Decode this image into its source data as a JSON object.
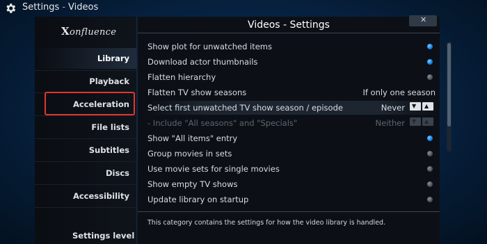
{
  "header": {
    "title": "Settings",
    "separator": "-",
    "subtitle": "Videos",
    "icon": "gear-icon"
  },
  "logo": {
    "first": "X",
    "rest": "onfluence"
  },
  "menu": {
    "items": [
      {
        "label": "Library"
      },
      {
        "label": "Playback"
      },
      {
        "label": "Acceleration"
      },
      {
        "label": "File lists"
      },
      {
        "label": "Subtitles"
      },
      {
        "label": "Discs"
      },
      {
        "label": "Accessibility"
      }
    ],
    "settings_level": "Settings level",
    "active_item": "Library",
    "highlighted_item": "Acceleration"
  },
  "panel": {
    "title": "Videos - Settings",
    "close_glyph": "✕",
    "rows": [
      {
        "label": "Show plot for unwatched items",
        "type": "toggle",
        "on": true
      },
      {
        "label": "Download actor thumbnails",
        "type": "toggle",
        "on": true
      },
      {
        "label": "Flatten hierarchy",
        "type": "toggle",
        "on": false
      },
      {
        "label": "Flatten TV show seasons",
        "type": "value",
        "value": "If only one season"
      },
      {
        "label": "Select first unwatched TV show season / episode",
        "type": "spinner",
        "value": "Never",
        "down": "▼",
        "up": "▲"
      },
      {
        "label": "- Include \"All seasons\" and \"Specials\"",
        "type": "spinner",
        "value": "Neither",
        "down": "▼",
        "up": "▲",
        "disabled": true
      },
      {
        "label": "Show \"All items\" entry",
        "type": "toggle",
        "on": true
      },
      {
        "label": "Group movies in sets",
        "type": "toggle",
        "on": false
      },
      {
        "label": "Use movie sets for single movies",
        "type": "toggle",
        "on": false
      },
      {
        "label": "Show empty TV shows",
        "type": "toggle",
        "on": false
      },
      {
        "label": "Update library on startup",
        "type": "toggle",
        "on": false
      }
    ],
    "description": "This category contains the settings for how the video library is handled."
  },
  "colors": {
    "focus": "#e2362e",
    "toggle_on": "#1780e6",
    "toggle_off": "#4a5057"
  }
}
